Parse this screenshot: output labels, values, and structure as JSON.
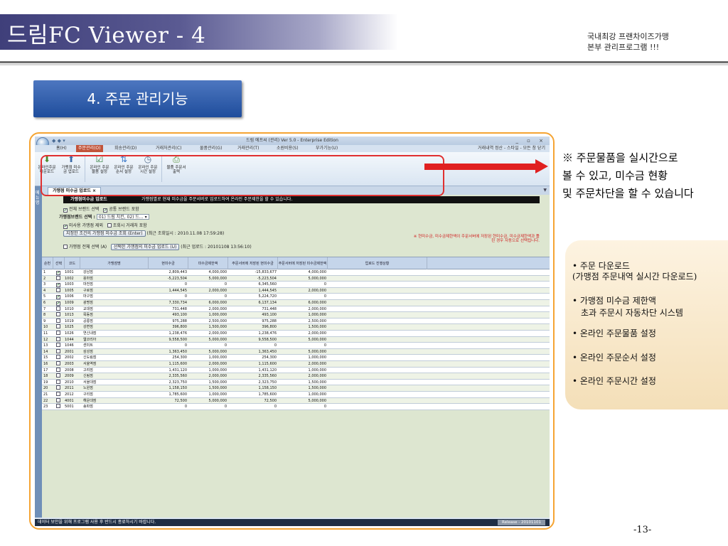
{
  "slide": {
    "title": "드림FC Viewer - 4",
    "tagline": [
      "국내최강 프랜차이즈가맹",
      "본부 관리프로그램 !!!"
    ],
    "section": "4. 주문 관리기능",
    "page_number": "-13-",
    "note_top": [
      "※ 주문물품을 실시간으로",
      "볼 수 있고, 미수금 현황",
      "및 주문차단을 할 수 있습니다"
    ],
    "features": [
      "• 주문 다운로드",
      "(가맹점 주문내역 실시간 다운로드)",
      "• 가맹점 미수금 제한액",
      "초과 주문시 자동차단 시스템",
      "• 온라인 주문물품 설정",
      "• 온라인 주문순서 설정",
      "• 온라인 주문시간 설정"
    ]
  },
  "app": {
    "window_title": "드림 에프씨 (관리) Ver 5.0 - Enterprise Edition",
    "window_buttons": "_ ▫ ×",
    "menu": [
      "홈(H)",
      "주문관리(O)",
      "회송관리(D)",
      "거래처관리(C)",
      "물품관리(G)",
      "거래관리(T)",
      "소원비용(S)",
      "부가기능(U)"
    ],
    "menu_right": "거래내역 정산 - 스타일 - 모든 창 닫기",
    "ribbon": [
      {
        "label": "온라인주문 다운로드",
        "icon": "download-icon"
      },
      {
        "label": "가맹점 미수금 업로드",
        "icon": "upload-icon"
      },
      {
        "label": "온라인 주문 물품 설정",
        "icon": "check-doc-icon"
      },
      {
        "label": "온라인 주문 순서 설정",
        "icon": "sort-icon"
      },
      {
        "label": "온라인 주문 시간 설정",
        "icon": "clock-icon"
      },
      {
        "label": "물품 주문서 출력",
        "icon": "print-icon"
      }
    ],
    "side_label": "메뉴명",
    "tab_label": "가맹점 미수금 업로드",
    "content": {
      "black_bar_title": "가맹점미수금 업로드",
      "black_bar_desc": "가맹점별로 현재 미수금을 주문서버로 업로드하여 온라인 주문제한을 할 수 있습니다.",
      "opt_all_brand": "전체 브랜드 선택",
      "opt_common_brand": "공통 브랜드 포함",
      "brand_label": "가맹점브랜드 선택 :",
      "brand_value": "01) 드림 치킨, 02) 드...",
      "opt_exclude_unused": "미사용 가맹점 제외",
      "opt_include_query": "조회시 거래처 포함",
      "query_button": "지정한 조건의 가맹점 미수금 조회 (Enter)",
      "last_query": "(최근 조회일시 : 2010.11.08 17:59:28)",
      "opt_select_all": "가맹점 전체 선택 (A)",
      "upload_button": "선택한 가맹점의 미수금 업로드 (U)",
      "last_upload": "(최근 업로드 : 20101108 13:56:10)",
      "red_note": "※ 현미수금, 미수금제한액이 주문서버에 저장된 현미수금, 미수금제한액과 틀린 경우 자동으로 선택됩니다."
    },
    "grid": {
      "headers": [
        "순번",
        "선택",
        "코드",
        "가맹점명",
        "현미수금",
        "미수금제한액",
        "주문서버에 저장된 현미수금",
        "주문서버에 저장된 미수금제한액",
        "업로드 진행상황"
      ],
      "rows": [
        [
          "1",
          true,
          "1001",
          "강남점",
          "2,809,443",
          "4,000,000",
          "-15,833,677",
          "4,000,000"
        ],
        [
          "2",
          false,
          "1002",
          "용마점",
          "-5,223,504",
          "5,000,000",
          "-5,223,504",
          "5,000,000"
        ],
        [
          "3",
          true,
          "1003",
          "마전점",
          "0",
          "0",
          "6,345,560",
          "0"
        ],
        [
          "4",
          false,
          "1005",
          "구로점",
          "1,444,545",
          "2,000,000",
          "1,444,545",
          "2,000,000"
        ],
        [
          "5",
          true,
          "1006",
          "마구점",
          "0",
          "0",
          "5,224,720",
          "0"
        ],
        [
          "6",
          true,
          "1009",
          "광명점",
          "7,330,734",
          "6,000,000",
          "6,137,134",
          "6,000,000"
        ],
        [
          "7",
          false,
          "1010",
          "교대점",
          "731,448",
          "2,000,000",
          "731,448",
          "2,000,000"
        ],
        [
          "8",
          false,
          "1013",
          "목동점",
          "493,100",
          "1,000,000",
          "493,100",
          "1,000,000"
        ],
        [
          "9",
          false,
          "1019",
          "공릉점",
          "975,288",
          "2,500,000",
          "975,288",
          "2,500,000"
        ],
        [
          "10",
          false,
          "1025",
          "강변점",
          "396,800",
          "1,500,000",
          "396,800",
          "1,500,000"
        ],
        [
          "11",
          false,
          "1026",
          "연신내점",
          "1,238,476",
          "2,000,000",
          "1,238,476",
          "2,000,000"
        ],
        [
          "12",
          false,
          "1044",
          "웹코리아",
          "9,558,500",
          "5,000,000",
          "9,558,500",
          "5,000,000"
        ],
        [
          "13",
          false,
          "1046",
          "센미트",
          "0",
          "0",
          "0",
          "0"
        ],
        [
          "14",
          false,
          "2001",
          "삼성점",
          "1,363,450",
          "5,000,000",
          "1,363,450",
          "5,000,000"
        ],
        [
          "15",
          false,
          "2002",
          "신도림점",
          "254,300",
          "1,000,000",
          "254,300",
          "1,000,000"
        ],
        [
          "16",
          false,
          "2003",
          "서울역점",
          "1,115,600",
          "2,000,000",
          "1,115,600",
          "2,000,000"
        ],
        [
          "17",
          false,
          "2008",
          "고려점",
          "1,431,120",
          "1,000,000",
          "1,431,120",
          "1,000,000"
        ],
        [
          "18",
          false,
          "2009",
          "신림점",
          "2,335,560",
          "2,000,000",
          "2,335,560",
          "2,000,000"
        ],
        [
          "19",
          false,
          "2010",
          "서울대점",
          "2,323,750",
          "1,500,000",
          "2,323,750",
          "1,500,000"
        ],
        [
          "20",
          false,
          "2011",
          "노원점",
          "1,158,150",
          "1,500,000",
          "1,158,150",
          "1,500,000"
        ],
        [
          "21",
          false,
          "2012",
          "구리점",
          "1,785,600",
          "1,000,000",
          "1,785,600",
          "1,000,000"
        ],
        [
          "22",
          false,
          "4001",
          "해운대점",
          "72,500",
          "5,000,000",
          "72,500",
          "5,000,000"
        ],
        [
          "23",
          false,
          "5001",
          "송파점",
          "0",
          "0",
          "0",
          "0"
        ]
      ]
    },
    "status_text": "데이터 보안을 위해 프로그램 사용 후 반드시 종료하시기 바랍니다.",
    "release_text": "Release - 20101101"
  },
  "colors": {
    "title_band": "#3f3f7a",
    "section_box": "#2a5aa8",
    "frame_border": "#f5a433",
    "highlight_red": "#e02020",
    "note_box": "#f4dfb8"
  }
}
